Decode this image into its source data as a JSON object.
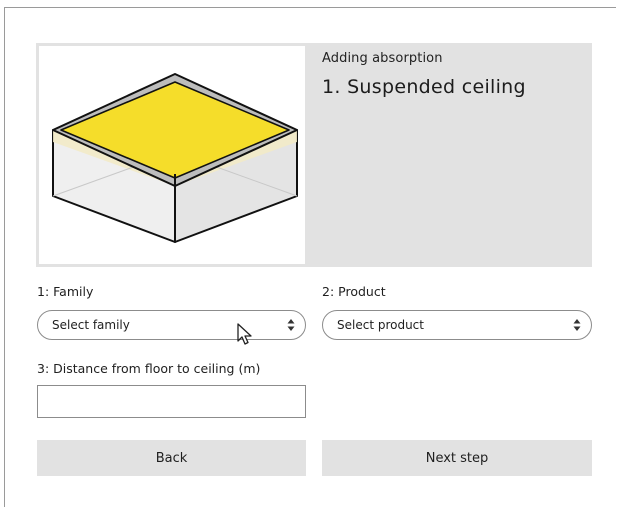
{
  "header": {
    "eyebrow": "Adding absorption",
    "title": "1. Suspended ceiling"
  },
  "illustration": {
    "icon": "suspended-ceiling-illustration",
    "ceiling_color": "#f5dd2a",
    "ceiling_band_color": "#f2eac6",
    "box_fill": "#f0f0f0"
  },
  "form": {
    "family": {
      "label": "1: Family",
      "value": "Select family"
    },
    "product": {
      "label": "2: Product",
      "value": "Select product"
    },
    "distance": {
      "label": "3: Distance from floor to ceiling (m)",
      "value": ""
    }
  },
  "buttons": {
    "back": "Back",
    "next": "Next step"
  },
  "colors": {
    "panel": "#e2e2e2",
    "border": "#8c8c8c"
  }
}
